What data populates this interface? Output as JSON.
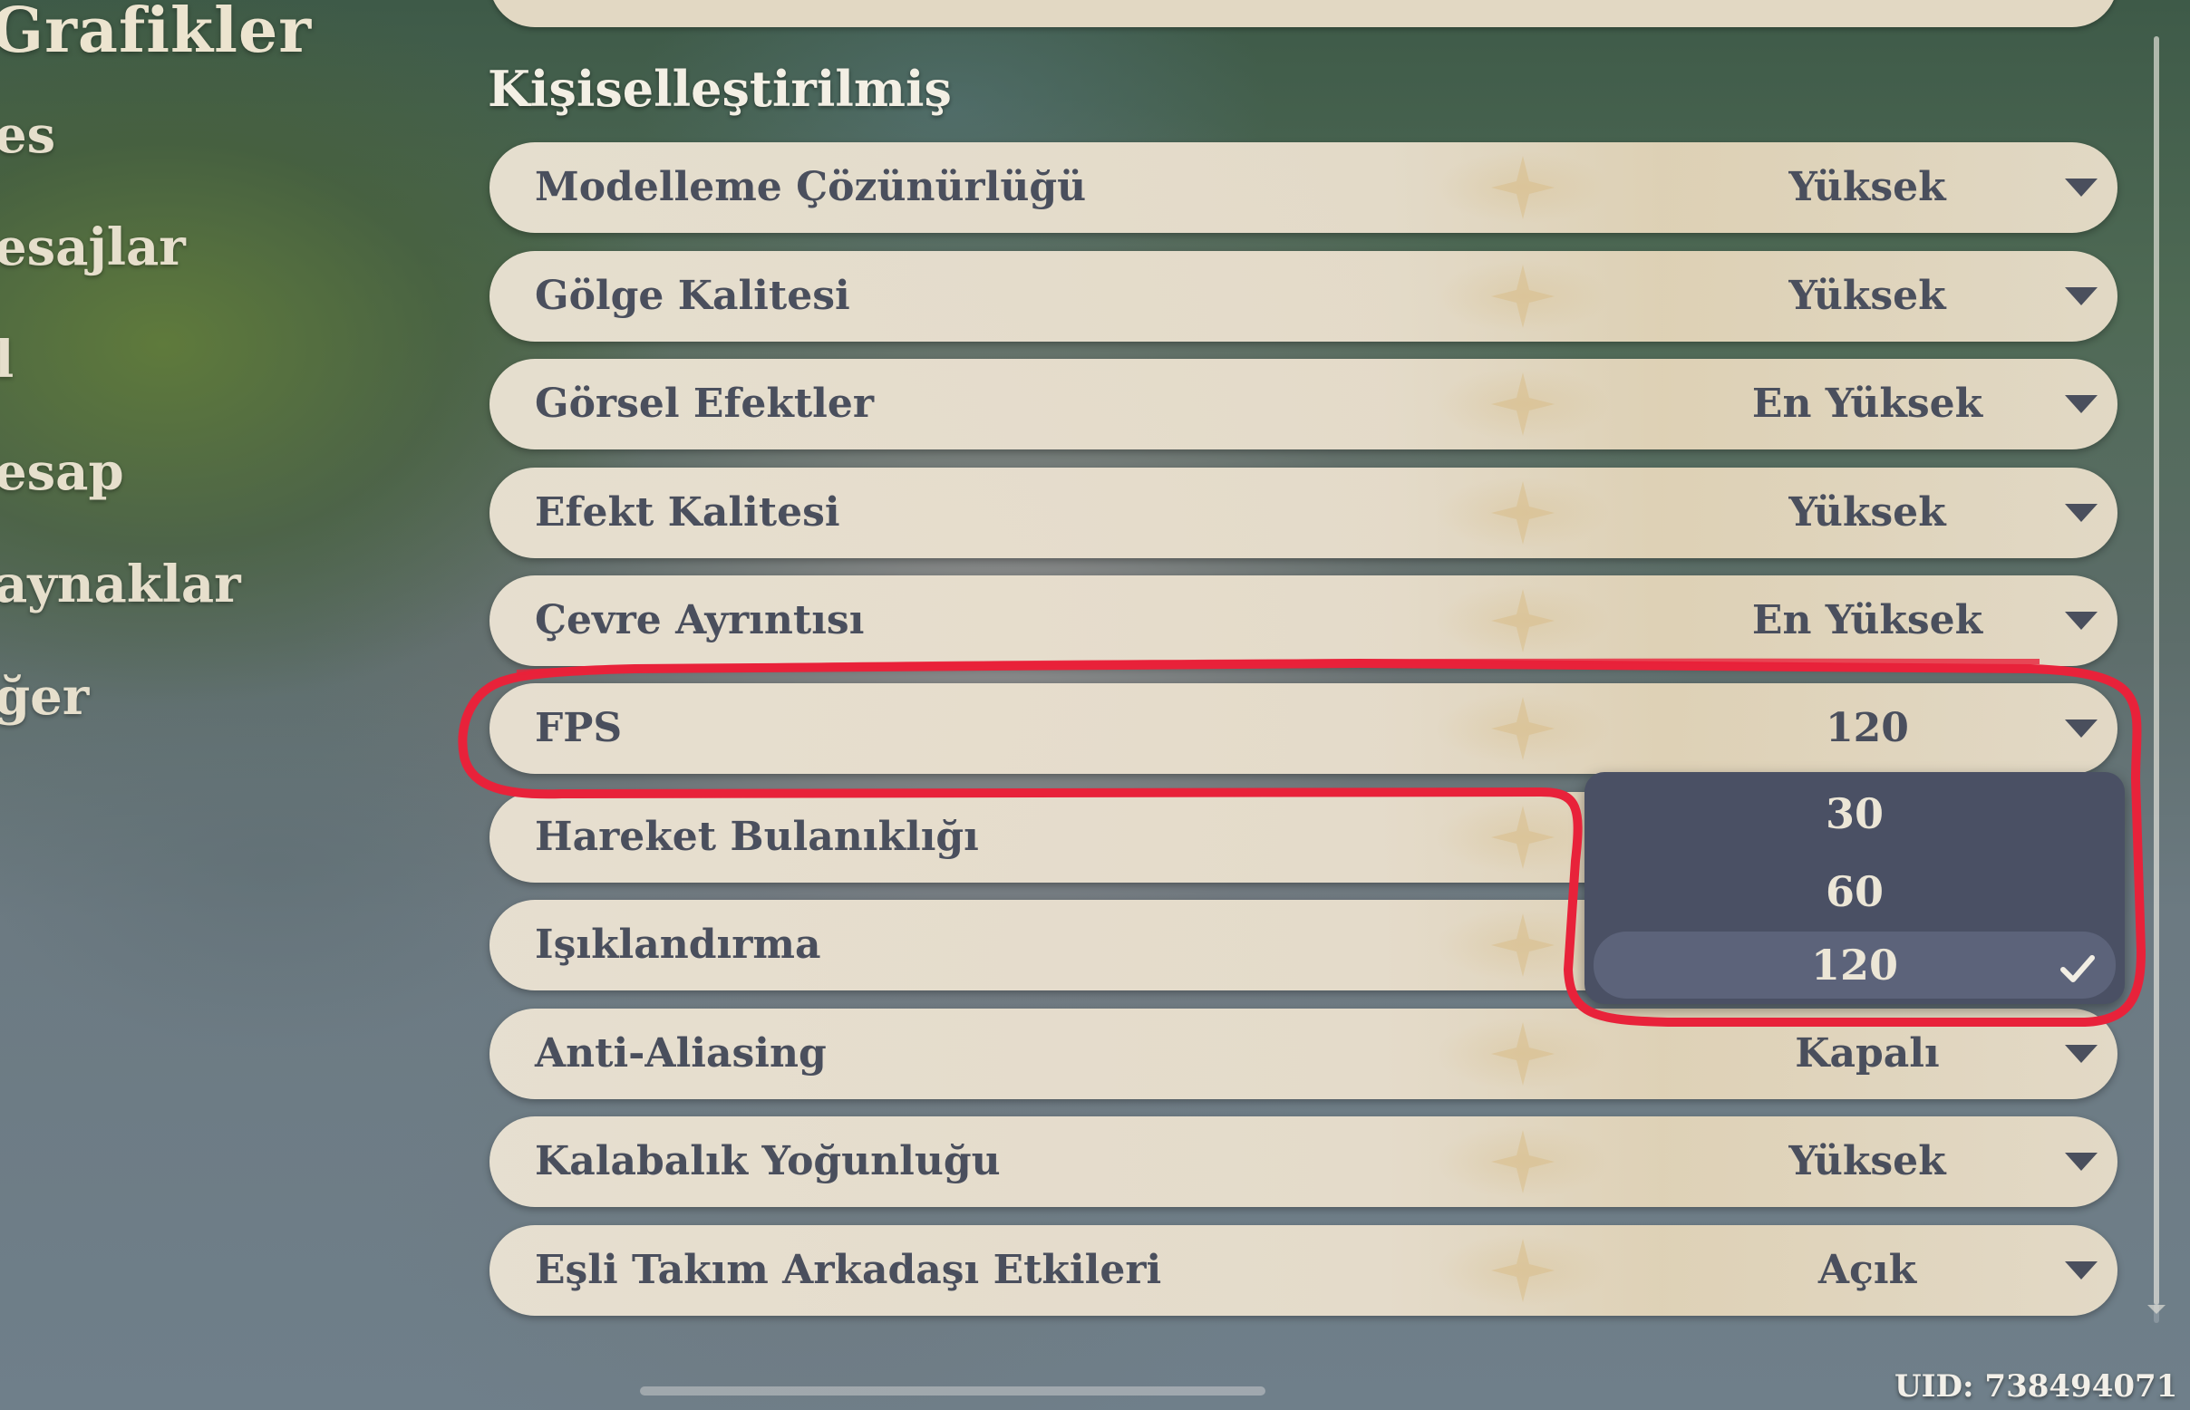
{
  "nav": {
    "title": "Grafikler",
    "items": [
      "es",
      "esajlar",
      "l",
      "esap",
      "aynaklar",
      "ğer"
    ]
  },
  "section": {
    "title": "Kişiselleştirilmiş"
  },
  "settings": [
    {
      "label": "Modelleme Çözünürlüğü",
      "value": "Yüksek"
    },
    {
      "label": "Gölge Kalitesi",
      "value": "Yüksek"
    },
    {
      "label": "Görsel Efektler",
      "value": "En Yüksek"
    },
    {
      "label": "Efekt Kalitesi",
      "value": "Yüksek"
    },
    {
      "label": "Çevre Ayrıntısı",
      "value": "En Yüksek"
    },
    {
      "label": "FPS",
      "value": "120"
    },
    {
      "label": "Hareket Bulanıklığı",
      "value": ""
    },
    {
      "label": "Işıklandırma",
      "value": ""
    },
    {
      "label": "Anti-Aliasing",
      "value": "Kapalı"
    },
    {
      "label": "Kalabalık Yoğunluğu",
      "value": "Yüksek"
    },
    {
      "label": "Eşli Takım Arkadaşı Etkileri",
      "value": "Açık"
    }
  ],
  "fps_dropdown": {
    "options": [
      "30",
      "60",
      "120"
    ],
    "selected": "120"
  },
  "uid": "UID: 738494071",
  "colors": {
    "row_bg": "#e8decc",
    "row_text": "#4a4f5d",
    "dropdown_bg": "#4a5064",
    "dropdown_selected": "#5c637a",
    "highlight": "#e8223a"
  }
}
